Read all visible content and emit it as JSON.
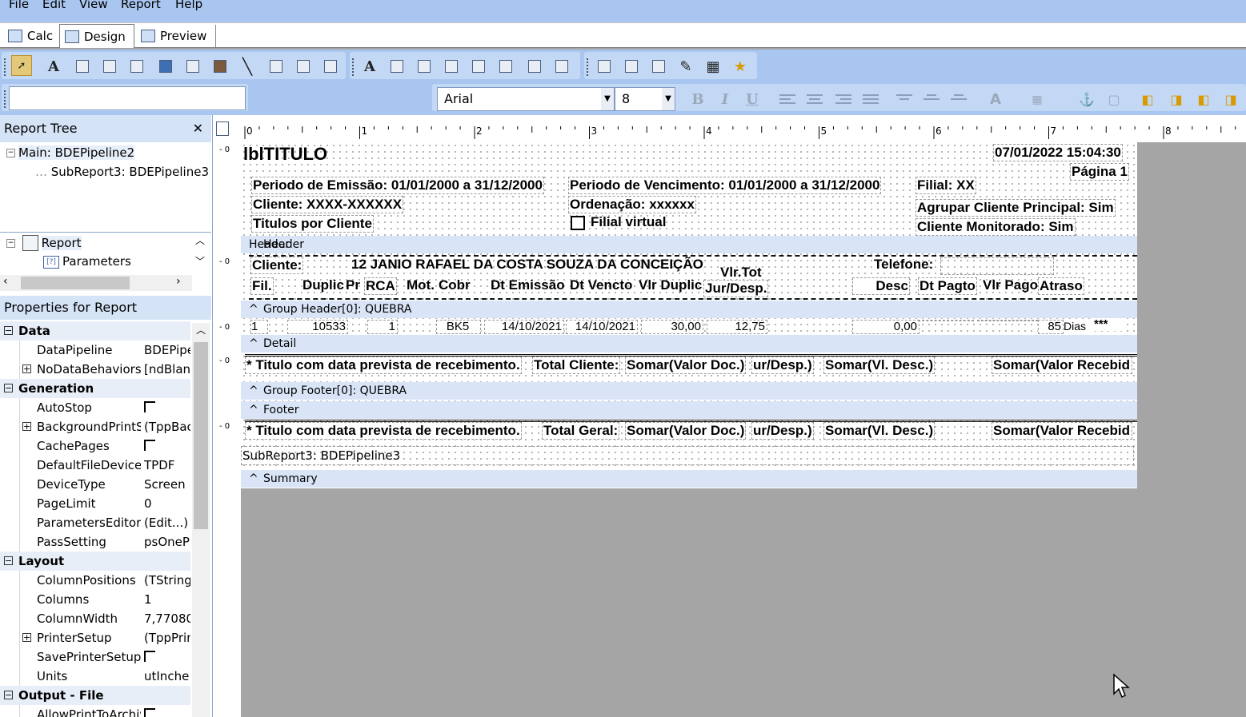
{
  "menu": [
    "File",
    "Edit",
    "View",
    "Report",
    "Help"
  ],
  "tabs": [
    {
      "label": "Calc"
    },
    {
      "label": "Design"
    },
    {
      "label": "Preview"
    }
  ],
  "toolbar": {
    "font_name": "Arial",
    "font_size": "8",
    "format_buttons": [
      "B",
      "I",
      "U"
    ]
  },
  "report_tree": {
    "title": "Report Tree",
    "close": "✕",
    "items": [
      "Main: BDEPipeline2",
      "SubReport3: BDEPipeline3"
    ],
    "data_tree": [
      "Report",
      "Parameters"
    ]
  },
  "properties": {
    "title": "Properties for Report",
    "rows": [
      {
        "kind": "cat",
        "name": "Data"
      },
      {
        "kind": "prop",
        "name": "DataPipeline",
        "value": "BDEPipe"
      },
      {
        "kind": "prop",
        "name": "NoDataBehaviors",
        "value": "[ndBlank",
        "expand": true
      },
      {
        "kind": "cat",
        "name": "Generation"
      },
      {
        "kind": "prop",
        "name": "AutoStop",
        "value": "",
        "check": true
      },
      {
        "kind": "prop",
        "name": "BackgroundPrintSe",
        "value": "(TppBac",
        "expand": true
      },
      {
        "kind": "prop",
        "name": "CachePages",
        "value": "",
        "check": true
      },
      {
        "kind": "prop",
        "name": "DefaultFileDevice",
        "value": "TPDF"
      },
      {
        "kind": "prop",
        "name": "DeviceType",
        "value": "Screen"
      },
      {
        "kind": "prop",
        "name": "PageLimit",
        "value": "0"
      },
      {
        "kind": "prop",
        "name": "ParametersEditor",
        "value": "(Edit...)"
      },
      {
        "kind": "prop",
        "name": "PassSetting",
        "value": "psOneP"
      },
      {
        "kind": "cat",
        "name": "Layout"
      },
      {
        "kind": "prop",
        "name": "ColumnPositions",
        "value": "(TString"
      },
      {
        "kind": "prop",
        "name": "Columns",
        "value": "1"
      },
      {
        "kind": "prop",
        "name": "ColumnWidth",
        "value": "7,77080"
      },
      {
        "kind": "prop",
        "name": "PrinterSetup",
        "value": "(TppPrin",
        "expand": true
      },
      {
        "kind": "prop",
        "name": "SavePrinterSetup",
        "value": "",
        "check": true
      },
      {
        "kind": "prop",
        "name": "Units",
        "value": "utInche"
      },
      {
        "kind": "cat",
        "name": "Output - File"
      },
      {
        "kind": "prop",
        "name": "AllowPrintToArchiv",
        "value": "",
        "check": true
      }
    ]
  },
  "ruler": [
    "0",
    "1",
    "2",
    "3",
    "4",
    "5",
    "6",
    "7",
    "8"
  ],
  "report": {
    "title": {
      "lbl_titulo": "lblTITULO",
      "datetime": "07/01/2022 15:04:30",
      "pagina": "Página 1",
      "periodo_emissao": "Periodo de Emissão: 01/01/2000 a 31/12/2000",
      "periodo_vencimento": "Periodo de Vencimento:  01/01/2000 a 31/12/2000",
      "filial": "Filial: XX",
      "cliente": "Cliente: XXXX-XXXXXX",
      "ordenacao": "Ordenação: xxxxxx",
      "agrupar": "Agrupar Cliente Principal: Sim",
      "titulos_por_cliente": "Titulos por Cliente",
      "filial_virtual": "Filial virtual",
      "cliente_monitorado": "Cliente Monitorado: Sim"
    },
    "bands": {
      "header": "Header",
      "group_header": "Group Header[0]: QUEBRA",
      "detail": "Detail",
      "group_footer": "Group Footer[0]: QUEBRA",
      "footer": "Footer",
      "summary": "Summary"
    },
    "header": {
      "cliente_label": "Cliente:",
      "cliente_name": "12 JANIO RAFAEL DA COSTA SOUZA DA CONCEIÇÃO",
      "vlr_tot": "Vlr.Tot",
      "jur_desp": "Jur/Desp.",
      "telefone": "Telefone:",
      "cols": [
        "Fil.",
        "Duplic",
        "Pr",
        "RCA",
        "Mot.",
        "Cobr",
        "Dt Emissão",
        "Dt Vencto",
        "Vlr Duplic",
        "Desc",
        "Dt Pagto",
        "Vlr Pago",
        "Atraso"
      ]
    },
    "detail": [
      "1",
      "10533",
      "1",
      "BK5",
      "14/10/2021",
      "14/10/2021",
      "30,00",
      "12,75",
      "0,00",
      "85",
      "Dias",
      "***"
    ],
    "group_footer": {
      "note": "* Titulo com data prevista  de recebimento.",
      "total": "Total Cliente:",
      "somar_doc": "Somar(Valor Doc.)",
      "ur_desp": "ur/Desp.)",
      "somar_desc": "Somar(Vl. Desc.)",
      "somar_receb": "Somar(Valor Recebid"
    },
    "footer": {
      "note": "* Titulo com data prevista  de recebimento.",
      "total": "Total Geral:",
      "somar_doc": "Somar(Valor Doc.)",
      "ur_desp": "ur/Desp.)",
      "somar_desc": "Somar(Vl. Desc.)",
      "somar_receb": "Somar(Valor Recebid",
      "subreport": "SubReport3: BDEPipeline3"
    }
  },
  "colors": {
    "chrome": "#a9c6f0",
    "panel_header": "#d5e3f7",
    "band": "#d9e5f7",
    "workspace": "#a5a5a5"
  }
}
